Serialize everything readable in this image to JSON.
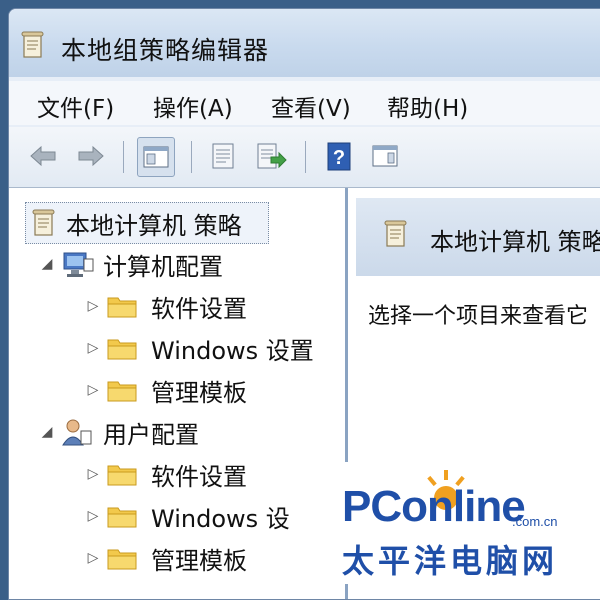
{
  "window": {
    "title": "本地组策略编辑器"
  },
  "menu": [
    {
      "label": "文件(F)"
    },
    {
      "label": "操作(A)"
    },
    {
      "label": "查看(V)"
    },
    {
      "label": "帮助(H)"
    }
  ],
  "toolbar": {
    "buttons": [
      "back-arrow-icon",
      "forward-arrow-icon",
      "show-hide-tree-icon",
      "properties-icon",
      "export-list-icon",
      "help-icon",
      "extended-view-icon"
    ]
  },
  "tree": {
    "root": "本地计算机 策略",
    "computer_config": {
      "label": "计算机配置",
      "children": [
        "软件设置",
        "Windows 设置",
        "管理模板"
      ]
    },
    "user_config": {
      "label": "用户配置",
      "children": [
        "软件设置",
        "Windows 设",
        "管理模板"
      ]
    }
  },
  "right_pane": {
    "header": "本地计算机 策略",
    "body": "选择一个项目来查看它"
  },
  "watermark": {
    "logo": "PConline",
    "domain": ".com.cn",
    "cn": "太平洋电脑网"
  },
  "colors": {
    "brand_blue": "#1f4fa8",
    "folder_yellow": "#f2c94c",
    "accent_orange": "#f0a020"
  }
}
